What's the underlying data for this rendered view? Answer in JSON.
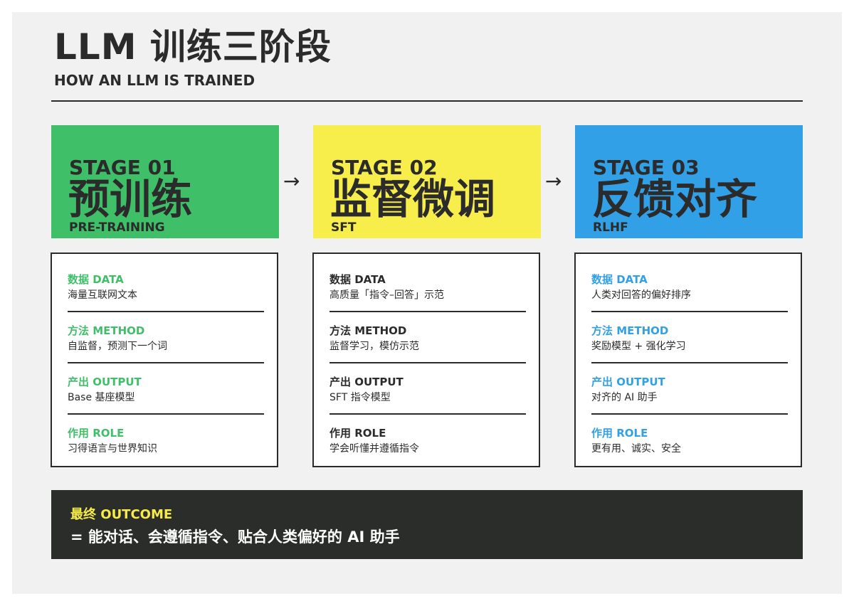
{
  "header": {
    "title": "LLM 训练三阶段",
    "subtitle": "HOW AN LLM IS TRAINED"
  },
  "arrows": [
    "→",
    "→"
  ],
  "stages": [
    {
      "label": "STAGE 01",
      "name": "预训练",
      "en": "PRE-TRAINING",
      "color": "#3fbf68",
      "label_color": "#3fbf68",
      "rows": [
        {
          "label": "数据 DATA",
          "value": "海量互联网文本"
        },
        {
          "label": "方法 METHOD",
          "value": "自监督，预测下一个词"
        },
        {
          "label": "产出 OUTPUT",
          "value": "Base 基座模型"
        },
        {
          "label": "作用 ROLE",
          "value": "习得语言与世界知识"
        }
      ]
    },
    {
      "label": "STAGE 02",
      "name": "监督微调",
      "en": "SFT",
      "color": "#f7ed4b",
      "label_color": "#2b2b2b",
      "rows": [
        {
          "label": "数据 DATA",
          "value": "高质量「指令–回答」示范"
        },
        {
          "label": "方法 METHOD",
          "value": "监督学习，模仿示范"
        },
        {
          "label": "产出 OUTPUT",
          "value": "SFT 指令模型"
        },
        {
          "label": "作用 ROLE",
          "value": "学会听懂并遵循指令"
        }
      ]
    },
    {
      "label": "STAGE 03",
      "name": "反馈对齐",
      "en": "RLHF",
      "color": "#32a0e6",
      "label_color": "#32a0e6",
      "rows": [
        {
          "label": "数据 DATA",
          "value": "人类对回答的偏好排序"
        },
        {
          "label": "方法 METHOD",
          "value": "奖励模型 + 强化学习"
        },
        {
          "label": "产出 OUTPUT",
          "value": "对齐的 AI 助手"
        },
        {
          "label": "作用 ROLE",
          "value": "更有用、诚实、安全"
        }
      ]
    }
  ],
  "outcome": {
    "label": "最终 OUTCOME",
    "text": "= 能对话、会遵循指令、贴合人类偏好的 AI 助手",
    "label_color": "#f6eb47"
  }
}
